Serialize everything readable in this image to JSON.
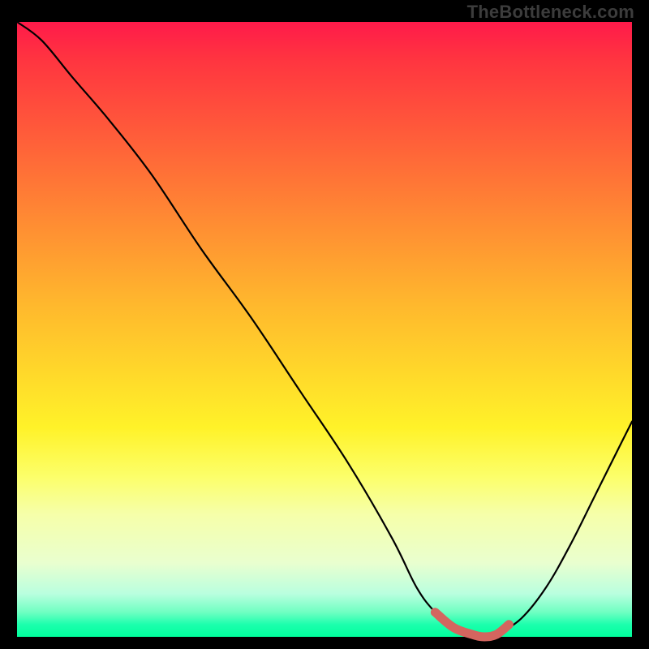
{
  "watermark": "TheBottleneck.com",
  "colors": {
    "background": "#000000",
    "curve": "#000000",
    "marker": "#d4655f"
  },
  "chart_data": {
    "type": "line",
    "title": "",
    "xlabel": "",
    "ylabel": "",
    "xlim": [
      0,
      100
    ],
    "ylim": [
      0,
      100
    ],
    "series": [
      {
        "name": "bottleneck-curve",
        "x": [
          0,
          4,
          9,
          15,
          22,
          30,
          38,
          46,
          54,
          61,
          65,
          68,
          71,
          74,
          76,
          78,
          82,
          86,
          90,
          94,
          98,
          100
        ],
        "y": [
          100,
          97,
          91,
          84,
          75,
          63,
          52,
          40,
          28,
          16,
          8,
          4,
          1.5,
          0.4,
          0,
          0.4,
          3,
          8,
          15,
          23,
          31,
          35
        ]
      }
    ],
    "highlight": {
      "name": "optimal-zone",
      "x": [
        68,
        71,
        74,
        76,
        78,
        80
      ],
      "y": [
        4,
        1.5,
        0.4,
        0,
        0.4,
        2
      ]
    }
  }
}
